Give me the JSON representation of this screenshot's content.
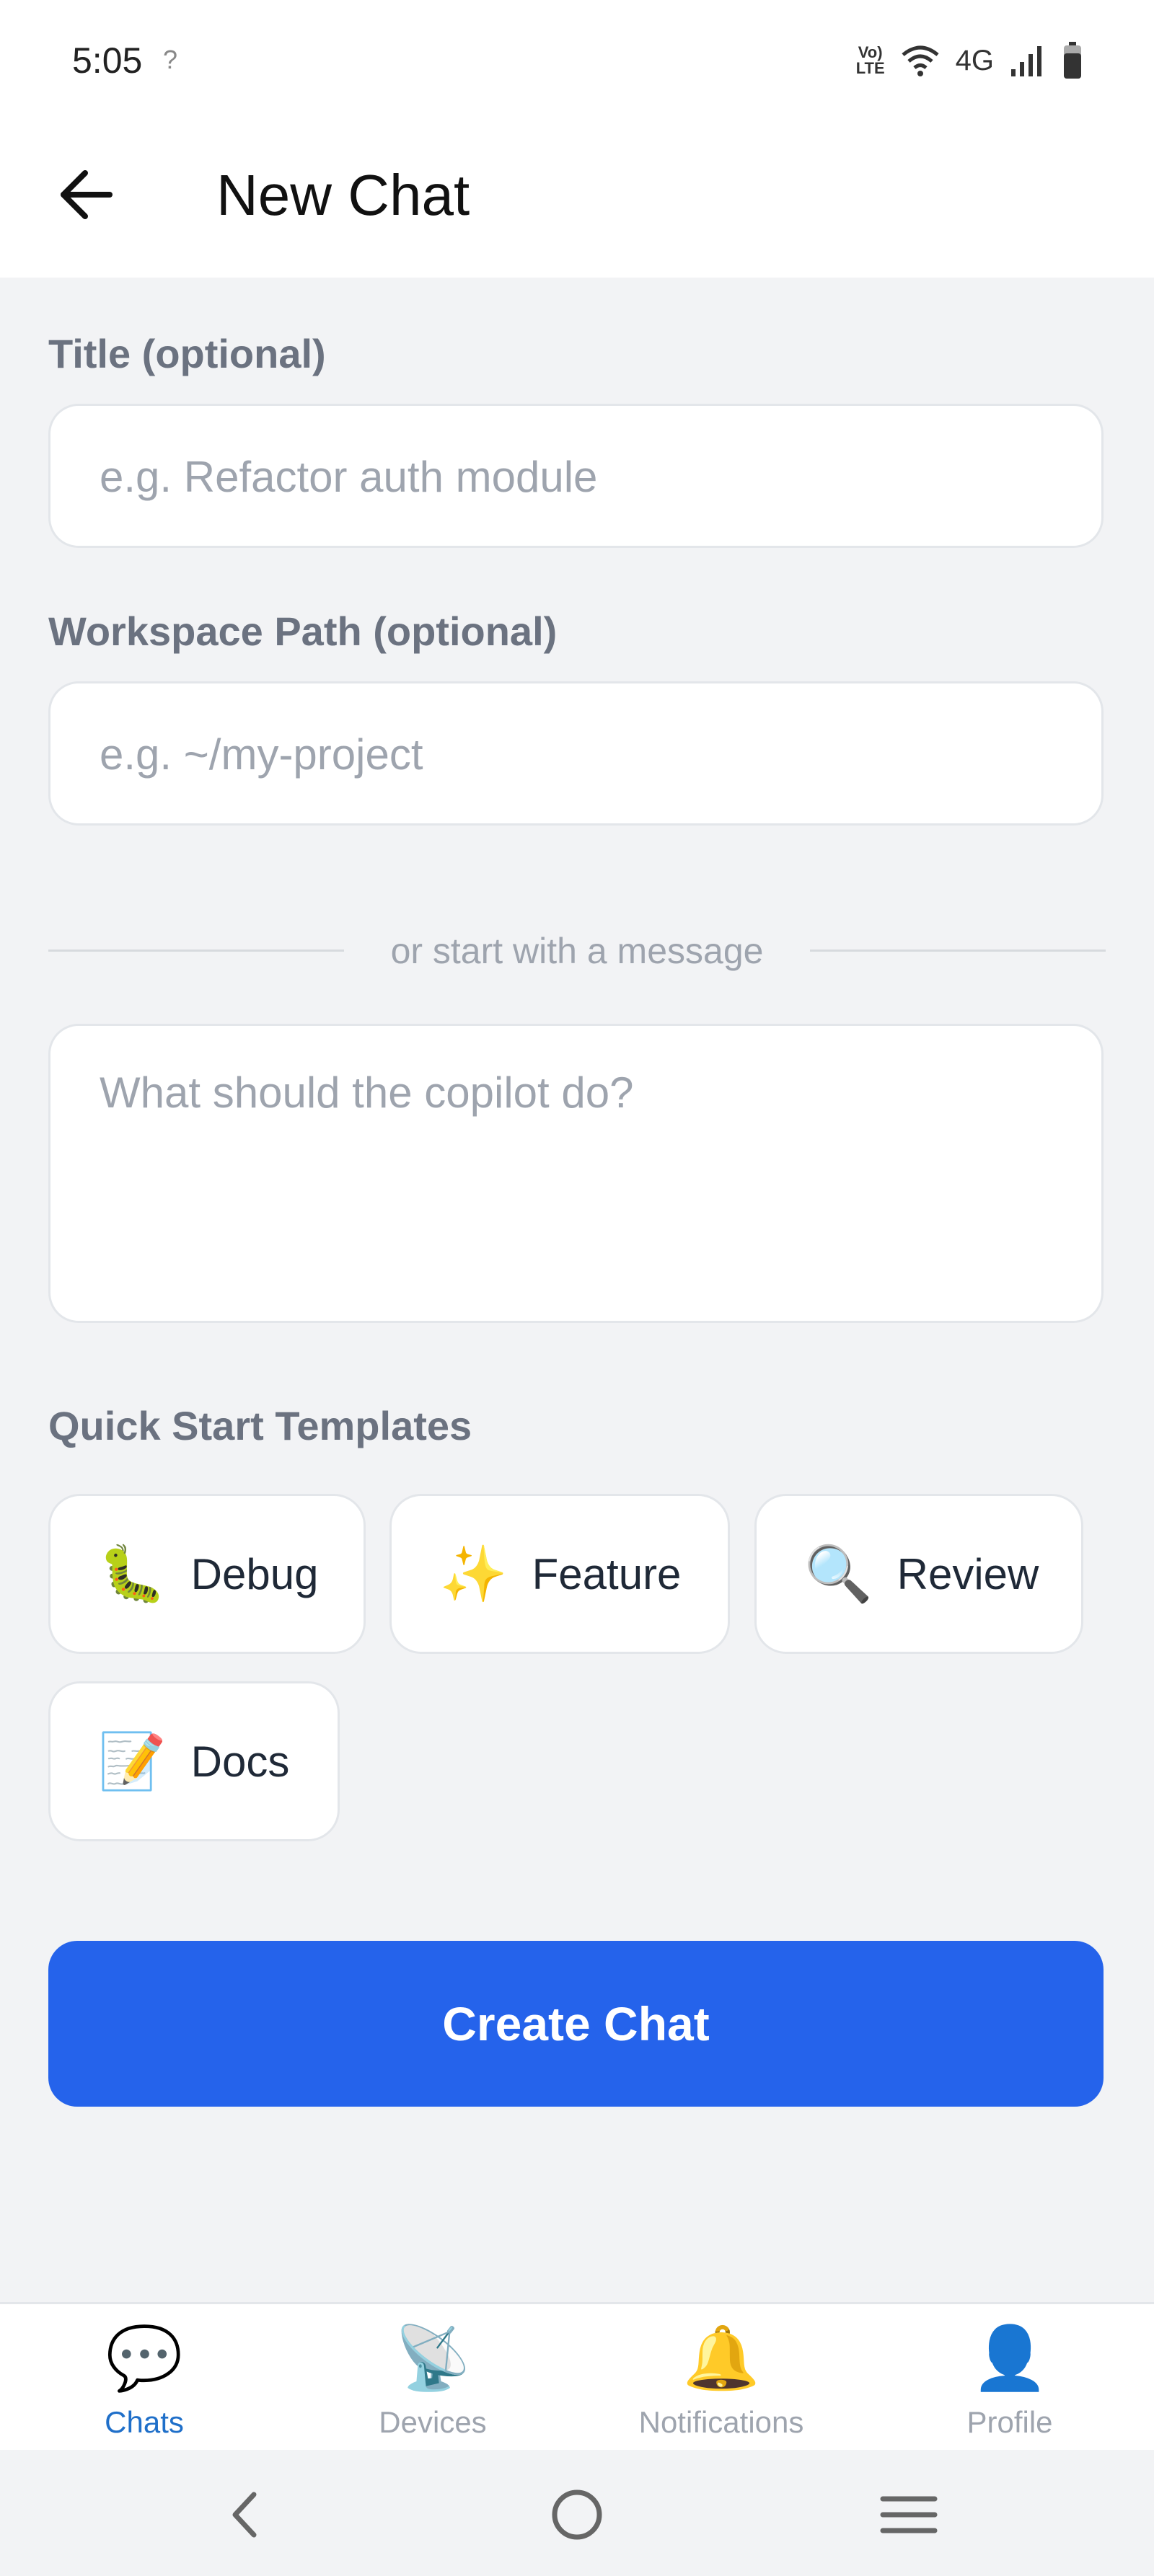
{
  "status_bar": {
    "time": "5:05",
    "unknown_signal": "?",
    "network": "4G",
    "lte_top": "Vo)",
    "lte_bottom": "LTE"
  },
  "header": {
    "title": "New Chat",
    "back_icon": "arrow-left-icon"
  },
  "form": {
    "title_label": "Title (optional)",
    "title_placeholder": "e.g. Refactor auth module",
    "title_value": "",
    "workspace_label": "Workspace Path (optional)",
    "workspace_placeholder": "e.g. ~/my-project",
    "workspace_value": "",
    "divider_text": "or start with a message",
    "message_placeholder": "What should the copilot do?",
    "message_value": ""
  },
  "templates": {
    "heading": "Quick Start Templates",
    "items": [
      {
        "emoji": "🐛",
        "label": "Debug"
      },
      {
        "emoji": "✨",
        "label": "Feature"
      },
      {
        "emoji": "🔍",
        "label": "Review"
      },
      {
        "emoji": "📝",
        "label": "Docs"
      }
    ]
  },
  "create_button_label": "Create Chat",
  "tabs": [
    {
      "icon": "💬",
      "label": "Chats",
      "active": true
    },
    {
      "icon": "📡",
      "label": "Devices",
      "active": false
    },
    {
      "icon": "🔔",
      "label": "Notifications",
      "active": false
    },
    {
      "icon": "👤",
      "label": "Profile",
      "active": false
    }
  ],
  "colors": {
    "accent": "#2563eb",
    "active_tab": "#1f6fc9",
    "background": "#f2f3f5"
  }
}
